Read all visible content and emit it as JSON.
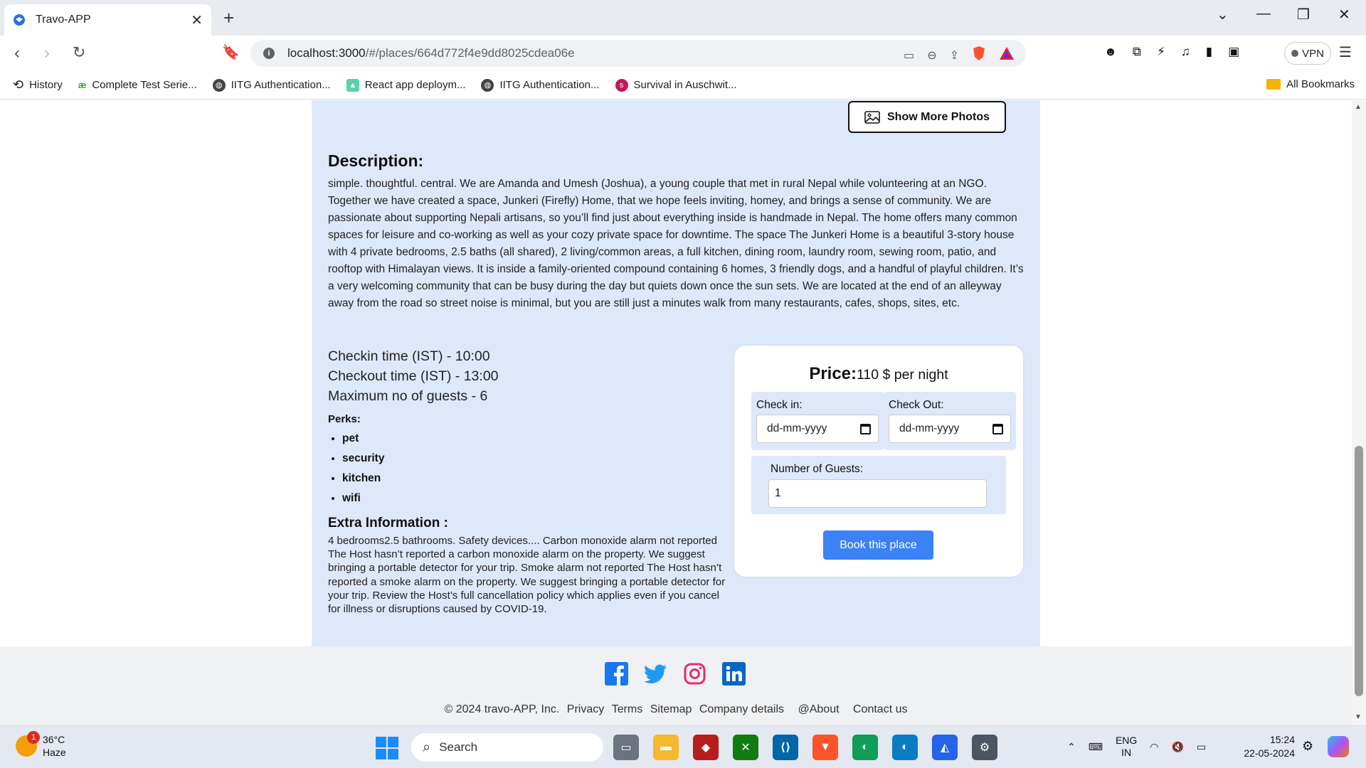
{
  "browser": {
    "tab_title": "Travo-APP",
    "url_host": "localhost:3000",
    "url_path": "/#/places/664d772f4e9dd8025cdea06e",
    "vpn_label": "VPN",
    "bookmarks": [
      {
        "label": "History"
      },
      {
        "label": "Complete Test Serie..."
      },
      {
        "label": "IITG Authentication..."
      },
      {
        "label": "React app deploym..."
      },
      {
        "label": "IITG Authentication..."
      },
      {
        "label": "Survival in Auschwit..."
      }
    ],
    "all_bookmarks": "All Bookmarks"
  },
  "place": {
    "show_more_label": "Show More Photos",
    "description_heading": "Description:",
    "description": "simple. thoughtful. central. We are Amanda and Umesh (Joshua), a young couple that met in rural Nepal while volunteering at an NGO. Together we have created a space, Junkeri (Firefly) Home, that we hope feels inviting, homey, and brings a sense of community. We are passionate about supporting Nepali artisans, so you’ll find just about everything inside is handmade in Nepal. The home offers many common spaces for leisure and co-working as well as your cozy private space for downtime. The space The Junkeri Home is a beautiful 3-story house with 4 private bedrooms, 2.5 baths (all shared), 2 living/common areas, a full kitchen, dining room, laundry room, sewing room, patio, and rooftop with Himalayan views. It is inside a family-oriented compound containing 6 homes, 3 friendly dogs, and a handful of playful children. It’s a very welcoming community that can be busy during the day but quiets down once the sun sets. We are located at the end of an alleyway away from the road so street noise is minimal, but you are still just a minutes walk from many restaurants, cafes, shops, sites, etc.",
    "checkin": "Checkin time (IST) - 10:00",
    "checkout": "Checkout time (IST) - 13:00",
    "max_guests": "Maximum no of guests - 6",
    "perks_heading": "Perks:",
    "perks": [
      "pet",
      "security",
      "kitchen",
      "wifi"
    ],
    "extra_heading": "Extra Information :",
    "extra_info": "4 bedrooms2.5 bathrooms. Safety devices.... Carbon monoxide alarm not reported The Host hasn’t reported a carbon monoxide alarm on the property. We suggest bringing a portable detector for your trip. Smoke alarm not reported The Host hasn’t reported a smoke alarm on the property. We suggest bringing a portable detector for your trip. Review the Host’s full cancellation policy which applies even if you cancel for illness or disruptions caused by COVID-19."
  },
  "booking": {
    "price_label": "Price:",
    "price_value": "110 $ per night",
    "checkin_label": "Check in:",
    "checkin_placeholder": "dd-mm-yyyy",
    "checkout_label": "Check Out:",
    "checkout_placeholder": "dd-mm-yyyy",
    "guests_label": "Number of Guests:",
    "guests_value": "1",
    "book_label": "Book this place"
  },
  "footer": {
    "copyright": "© 2024 travo-APP, Inc.",
    "links": [
      "Privacy",
      "Terms",
      "Sitemap",
      "Company details",
      "@About",
      "Contact us"
    ],
    "socials": [
      "facebook-icon",
      "twitter-icon",
      "instagram-icon",
      "linkedin-icon"
    ]
  },
  "taskbar": {
    "temperature": "36°C",
    "condition": "Haze",
    "weather_badge": "1",
    "search_label": "Search",
    "lang_top": "ENG",
    "lang_bottom": "IN",
    "time": "15:24",
    "date": "22-05-2024"
  },
  "colors": {
    "panel_bg": "#dde8fb",
    "book_button": "#3b82f6",
    "footer_bg": "#f0f1f3"
  }
}
